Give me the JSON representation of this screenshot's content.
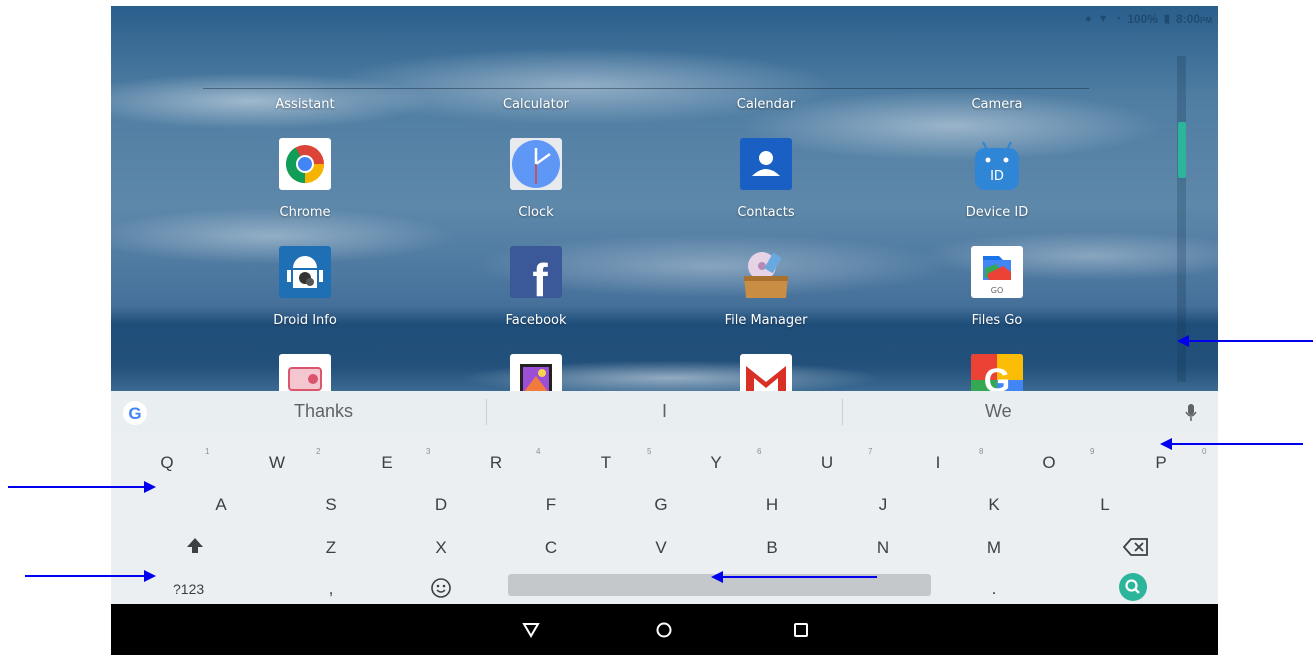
{
  "status_bar": {
    "battery": "100%",
    "time": "8:00",
    "ampm": "PM",
    "icons": [
      "location-icon",
      "wifi-icon",
      "signal-icon",
      "battery-icon"
    ]
  },
  "apps": [
    {
      "label": "Assistant"
    },
    {
      "label": "Calculator"
    },
    {
      "label": "Calendar"
    },
    {
      "label": "Camera"
    },
    {
      "label": "Chrome",
      "icon": "chrome-icon"
    },
    {
      "label": "Clock",
      "icon": "clock-icon"
    },
    {
      "label": "Contacts",
      "icon": "contacts-icon"
    },
    {
      "label": "Device ID",
      "icon": "device-id-icon",
      "icon_text": "ID"
    },
    {
      "label": "Droid Info",
      "icon": "droid-info-icon"
    },
    {
      "label": "Facebook",
      "icon": "facebook-icon",
      "icon_text": "f"
    },
    {
      "label": "File Manager",
      "icon": "file-manager-icon"
    },
    {
      "label": "Files Go",
      "icon": "files-go-icon",
      "icon_text": "GO"
    }
  ],
  "partial_apps": [
    "radio-app-icon",
    "gallery-app-icon",
    "gmail-icon",
    "google-icon"
  ],
  "keyboard": {
    "suggestions": [
      "Thanks",
      "I",
      "We"
    ],
    "row1": [
      {
        "k": "Q",
        "h": "1"
      },
      {
        "k": "W",
        "h": "2"
      },
      {
        "k": "E",
        "h": "3"
      },
      {
        "k": "R",
        "h": "4"
      },
      {
        "k": "T",
        "h": "5"
      },
      {
        "k": "Y",
        "h": "6"
      },
      {
        "k": "U",
        "h": "7"
      },
      {
        "k": "I",
        "h": "8"
      },
      {
        "k": "O",
        "h": "9"
      },
      {
        "k": "P",
        "h": "0"
      }
    ],
    "row2": [
      "A",
      "S",
      "D",
      "F",
      "G",
      "H",
      "J",
      "K",
      "L"
    ],
    "row3": [
      "Z",
      "X",
      "C",
      "V",
      "B",
      "N",
      "M"
    ],
    "symbols_key": "?123",
    "comma_key": ",",
    "period_key": "."
  },
  "colors": {
    "accent": "#2bb59b",
    "arrow": "#0000ee",
    "nav_bar": "#000000",
    "keyboard_bg": "#eceff1"
  }
}
